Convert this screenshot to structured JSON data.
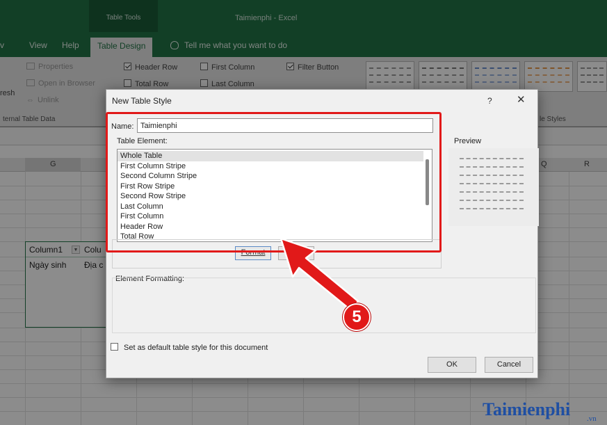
{
  "ribbon": {
    "context_tab_group": "Table Tools",
    "app_title": "Taimienphi  -  Excel",
    "tabs": [
      "View",
      "Help",
      "Table Design"
    ],
    "active_tab": "Table Design",
    "tell_me": "Tell me what you want to do",
    "external_data": {
      "properties": "Properties",
      "open_in_browser": "Open in Browser",
      "unlink": "Unlink",
      "refresh_partial": "resh",
      "group_label": "ternal Table Data"
    },
    "style_options": {
      "header_row": "Header Row",
      "first_column": "First Column",
      "filter_button": "Filter Button",
      "total_row": "Total Row",
      "last_column": "Last Column",
      "header_row_checked": true,
      "first_column_checked": false,
      "filter_button_checked": true,
      "total_row_checked": false,
      "last_column_checked": false
    },
    "table_styles_label": "le Styles"
  },
  "sheet": {
    "columns": [
      "G",
      "Q",
      "R"
    ],
    "table": {
      "header": [
        "Column1",
        "Colu"
      ],
      "row1": [
        "Ngày sinh",
        "Địa c"
      ]
    }
  },
  "dialog": {
    "title": "New Table Style",
    "help": "?",
    "close": "✕",
    "name_label": "Name:",
    "name_value": "Taimienphi",
    "table_element_label": "Table Element:",
    "table_elements": [
      "Whole Table",
      "First Column Stripe",
      "Second Column Stripe",
      "First Row Stripe",
      "Second Row Stripe",
      "Last Column",
      "First Column",
      "Header Row",
      "Total Row"
    ],
    "selected_element": "Whole Table",
    "preview_label": "Preview",
    "format_button": "Format",
    "element_formatting_label": "Element Formatting:",
    "default_checkbox_label": "Set as default table style for this document",
    "default_checked": false,
    "ok": "OK",
    "cancel": "Cancel"
  },
  "annotation": {
    "step_number": "5",
    "color": "#e11919"
  },
  "watermark": {
    "text": "aimienphi",
    "initial": "T",
    "suffix": ".vn"
  },
  "colors": {
    "excel_green": "#217346",
    "annotation_red": "#e11919",
    "watermark_blue": "#1f4fa3"
  }
}
